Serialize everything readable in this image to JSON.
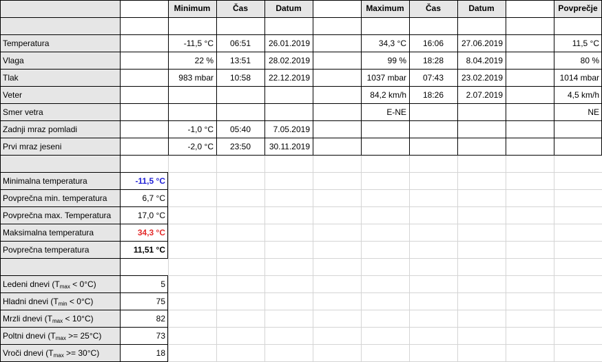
{
  "header": {
    "minimum": "Minimum",
    "cas1": "Čas",
    "datum1": "Datum",
    "maximum": "Maximum",
    "cas2": "Čas",
    "datum2": "Datum",
    "povprecje": "Povprečje"
  },
  "rows": [
    {
      "label": "Temperatura",
      "min": "-11,5 °C",
      "min_time": "06:51",
      "min_date": "26.01.2019",
      "max": "34,3 °C",
      "max_time": "16:06",
      "max_date": "27.06.2019",
      "avg": "11,5 °C"
    },
    {
      "label": "Vlaga",
      "min": "22 %",
      "min_time": "13:51",
      "min_date": "28.02.2019",
      "max": "99 %",
      "max_time": "18:28",
      "max_date": "8.04.2019",
      "avg": "80 %"
    },
    {
      "label": "Tlak",
      "min": "983 mbar",
      "min_time": "10:58",
      "min_date": "22.12.2019",
      "max": "1037 mbar",
      "max_time": "07:43",
      "max_date": "23.02.2019",
      "avg": "1014 mbar"
    },
    {
      "label": "Veter",
      "min": "",
      "min_time": "",
      "min_date": "",
      "max": "84,2 km/h",
      "max_time": "18:26",
      "max_date": "2.07.2019",
      "avg": "4,5 km/h"
    },
    {
      "label": "Smer vetra",
      "min": "",
      "min_time": "",
      "min_date": "",
      "max": "E-NE",
      "max_time": "",
      "max_date": "",
      "avg": "NE"
    },
    {
      "label": "Zadnji mraz pomladi",
      "min": "-1,0 °C",
      "min_time": "05:40",
      "min_date": "7.05.2019",
      "max": "",
      "max_time": "",
      "max_date": "",
      "avg": ""
    },
    {
      "label": "Prvi mraz jeseni",
      "min": "-2,0 °C",
      "min_time": "23:50",
      "min_date": "30.11.2019",
      "max": "",
      "max_time": "",
      "max_date": "",
      "avg": ""
    }
  ],
  "temps": [
    {
      "label": "Minimalna temperatura",
      "value": "-11,5 °C",
      "color": "#1f1fd6"
    },
    {
      "label": "Povprečna min. temperatura",
      "value": "6,7 °C"
    },
    {
      "label": "Povprečna max. Temperatura",
      "value": "17,0 °C"
    },
    {
      "label": "Maksimalna temperatura",
      "value": "34,3 °C",
      "color": "#e32b2b"
    },
    {
      "label": "Povprečna temperatura",
      "value": "11,51 °C"
    }
  ],
  "days": [
    {
      "pre": "Ledeni dnevi (T",
      "sub": "max",
      "post": " < 0°C)",
      "value": "5"
    },
    {
      "pre": "Hladni dnevi (T",
      "sub": "min",
      "post": " < 0°C)",
      "value": "75"
    },
    {
      "pre": "Mrzli dnevi (T",
      "sub": "max",
      "post": " < 10°C)",
      "value": "82"
    },
    {
      "pre": "Poltni dnevi (T",
      "sub": "max",
      "post": " >= 25°C)",
      "value": "73"
    },
    {
      "pre": "Vroči dnevi (T",
      "sub": "max",
      "post": " >= 30°C)",
      "value": "18"
    }
  ]
}
